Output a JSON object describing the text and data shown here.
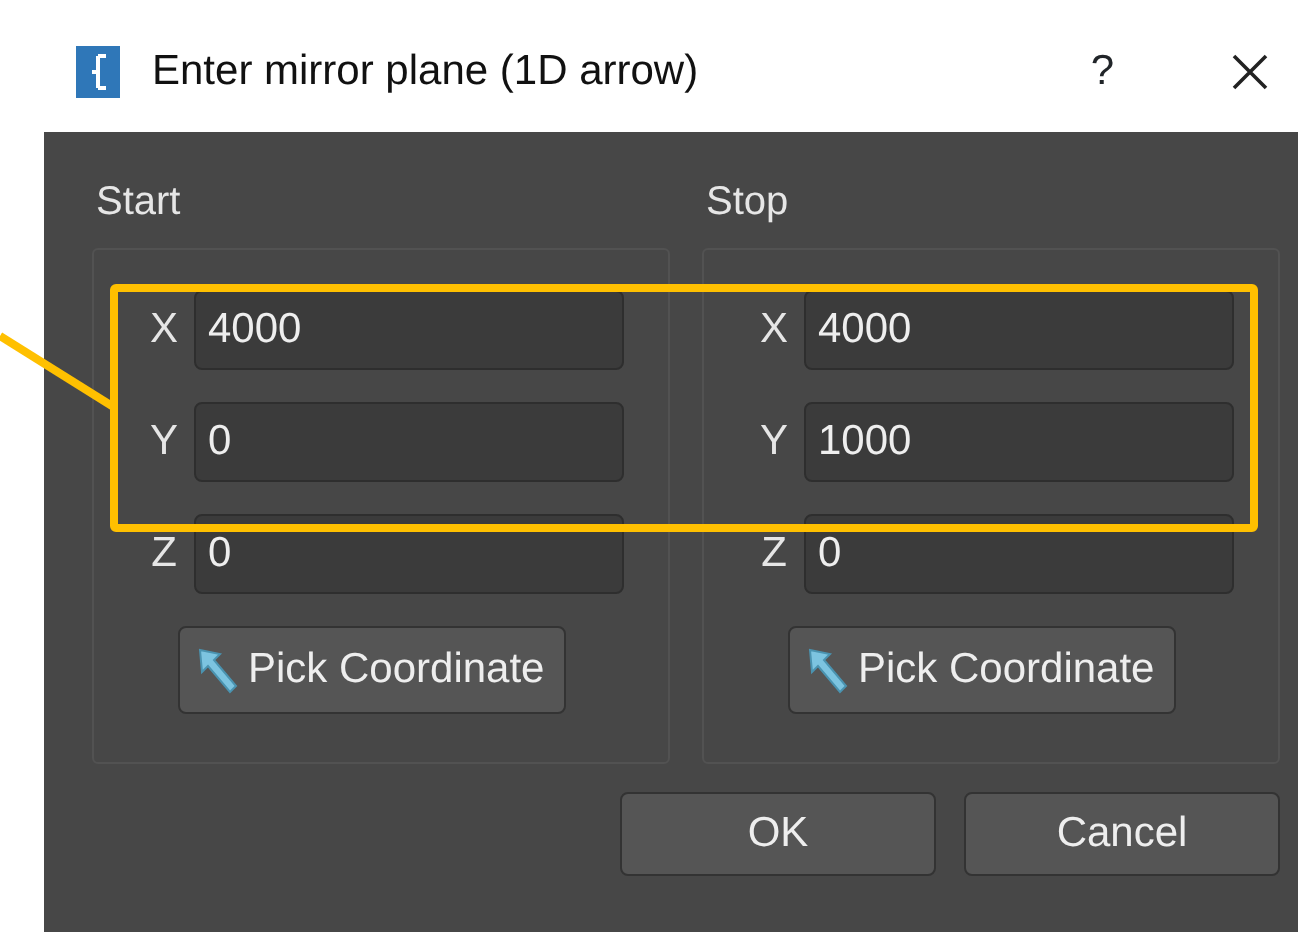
{
  "window": {
    "title": "Enter mirror plane (1D arrow)",
    "help": "?"
  },
  "groups": [
    {
      "title": "Start",
      "fields": [
        {
          "label": "X",
          "value": "4000"
        },
        {
          "label": "Y",
          "value": "0"
        },
        {
          "label": "Z",
          "value": "0"
        }
      ],
      "button": "Pick Coordinate"
    },
    {
      "title": "Stop",
      "fields": [
        {
          "label": "X",
          "value": "4000"
        },
        {
          "label": "Y",
          "value": "1000"
        },
        {
          "label": "Z",
          "value": "0"
        }
      ],
      "button": "Pick Coordinate"
    }
  ],
  "buttons": [
    "OK",
    "Cancel"
  ]
}
